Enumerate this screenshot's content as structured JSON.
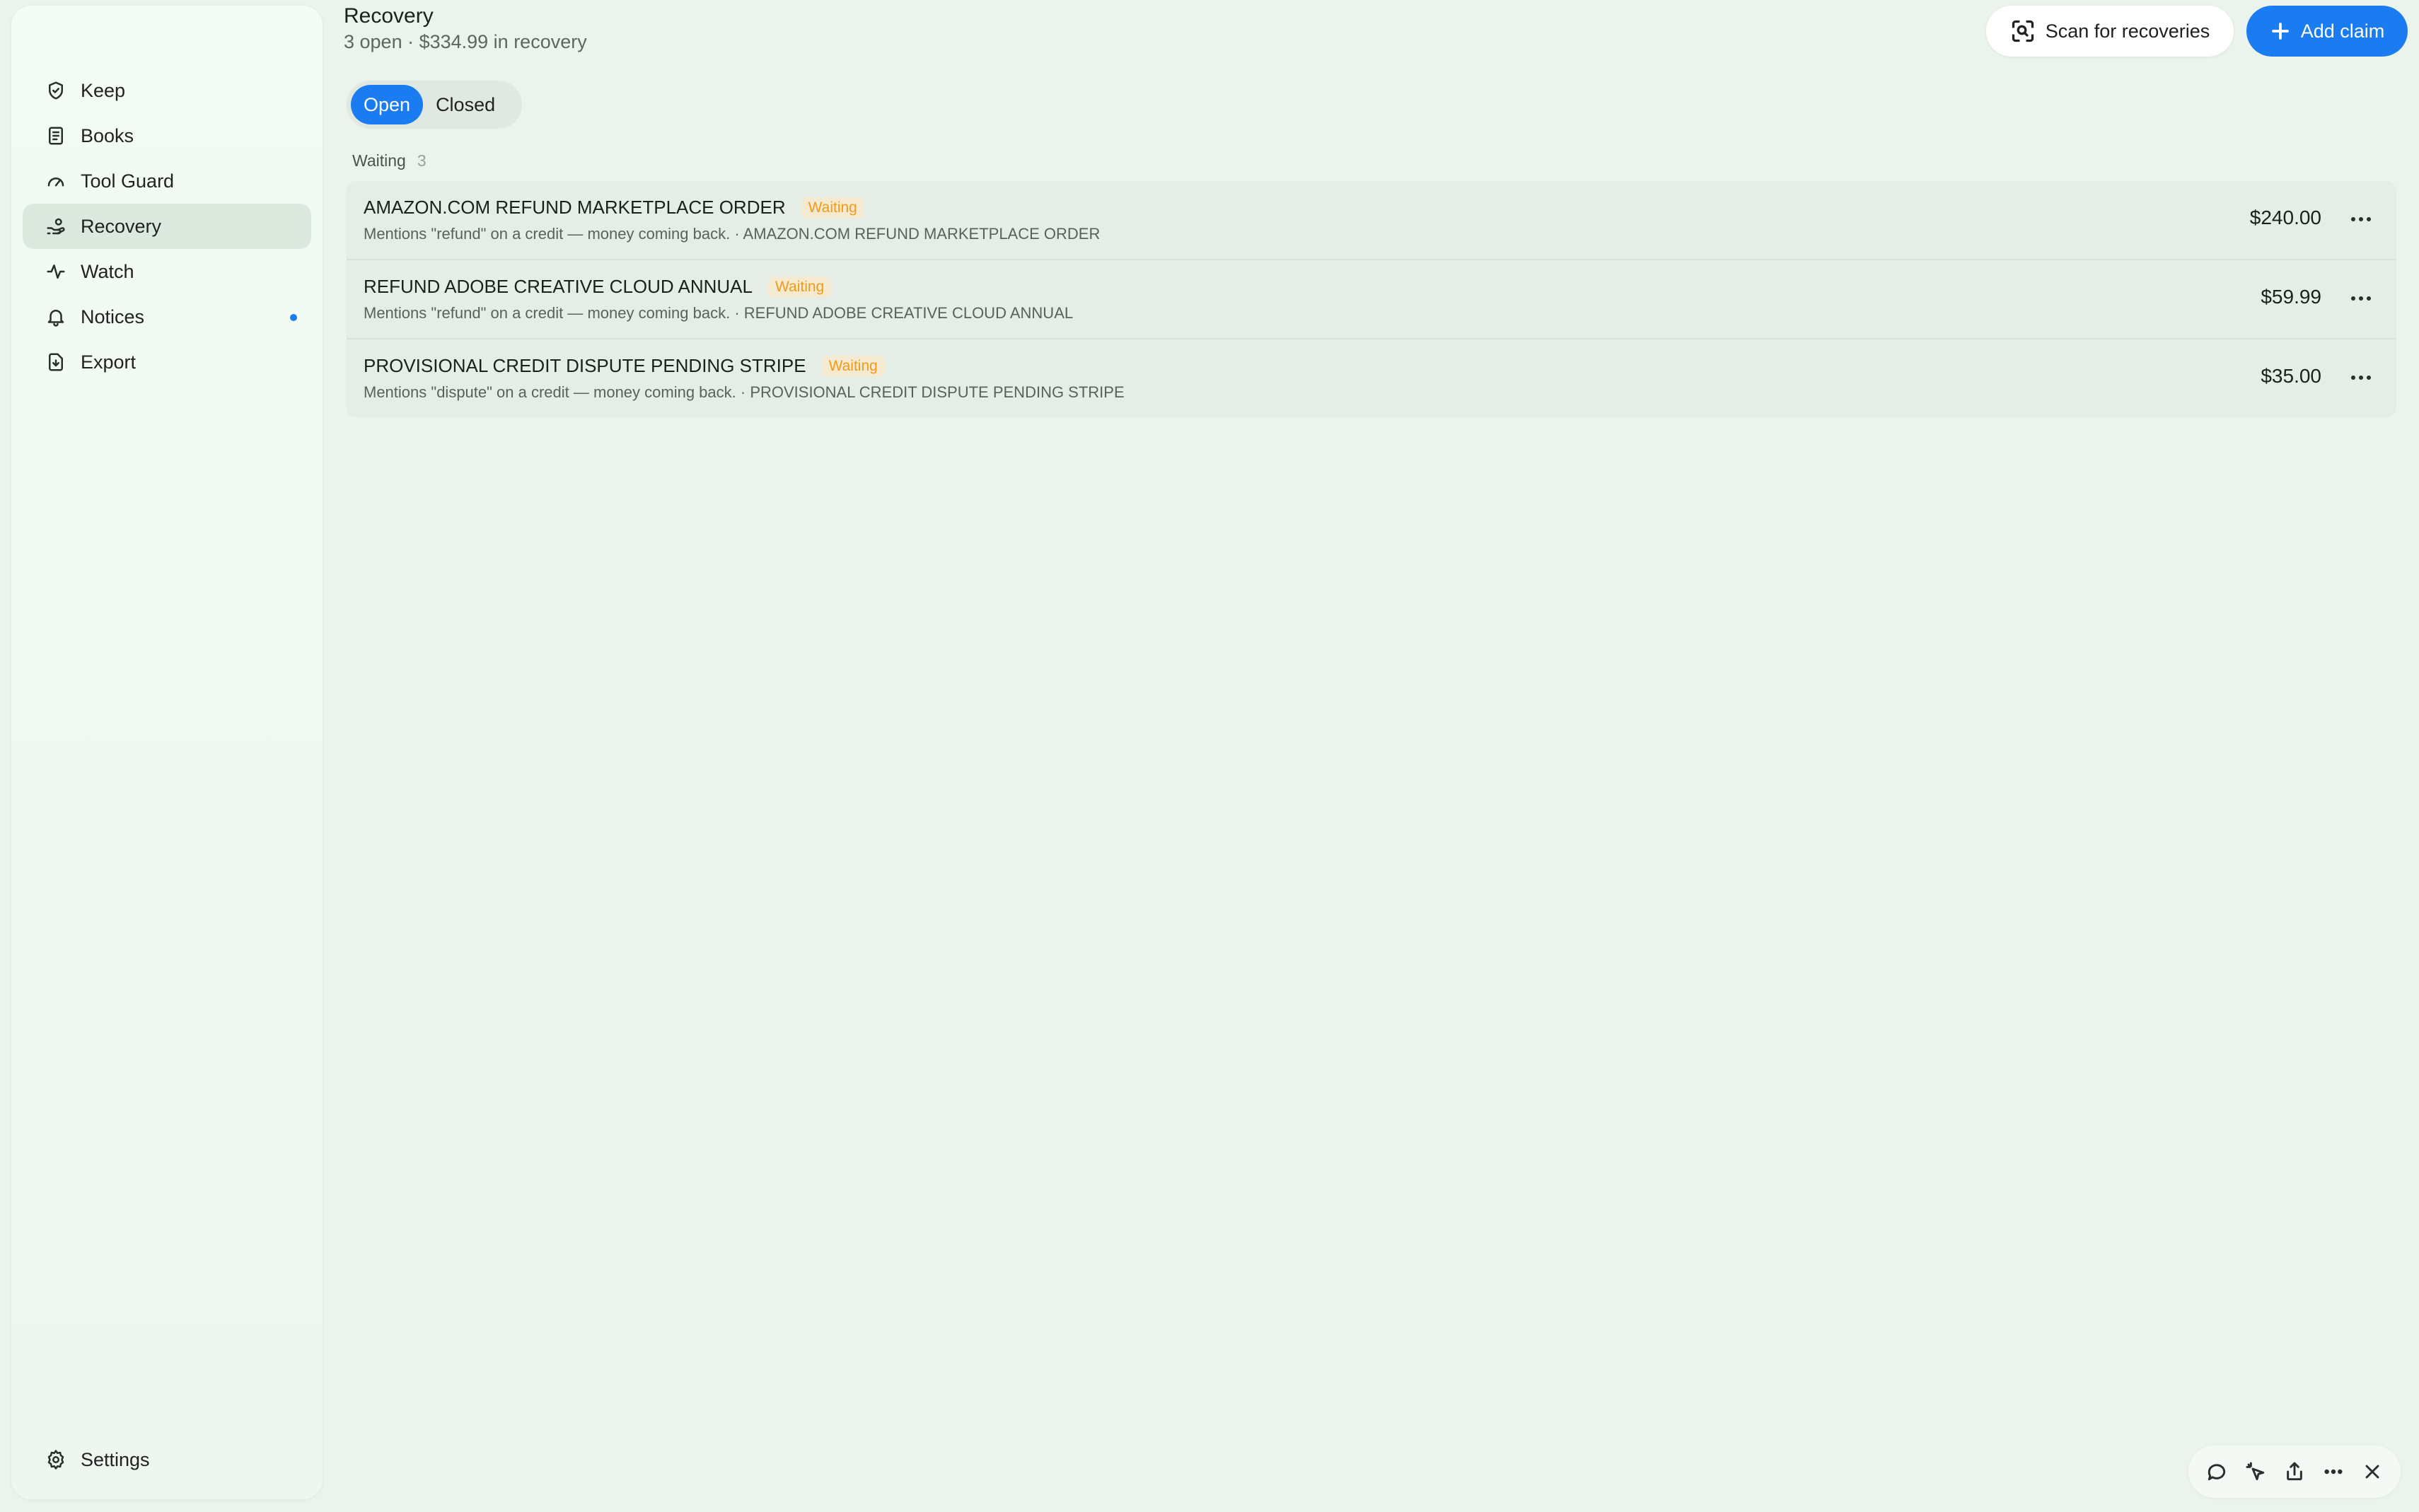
{
  "sidebar": {
    "items": [
      {
        "label": "Keep",
        "icon": "shield-check-icon"
      },
      {
        "label": "Books",
        "icon": "book-icon"
      },
      {
        "label": "Tool Guard",
        "icon": "gauge-icon"
      },
      {
        "label": "Recovery",
        "icon": "hand-coins-icon",
        "active": true
      },
      {
        "label": "Watch",
        "icon": "activity-icon"
      },
      {
        "label": "Notices",
        "icon": "bell-icon",
        "has_dot": true
      },
      {
        "label": "Export",
        "icon": "file-download-icon"
      }
    ],
    "settings_label": "Settings"
  },
  "header": {
    "title": "Recovery",
    "subtitle": "3 open · $334.99 in recovery"
  },
  "actions": {
    "scan_label": "Scan for recoveries",
    "add_label": "Add claim"
  },
  "tabs": {
    "open_label": "Open",
    "closed_label": "Closed",
    "selected": "Open"
  },
  "group": {
    "label": "Waiting",
    "count": "3"
  },
  "claims": [
    {
      "title": "AMAZON.COM REFUND MARKETPLACE ORDER",
      "status": "Waiting",
      "description": "Mentions \"refund\" on a credit — money coming back. · AMAZON.COM REFUND MARKETPLACE ORDER",
      "amount": "$240.00"
    },
    {
      "title": "REFUND ADOBE CREATIVE CLOUD ANNUAL",
      "status": "Waiting",
      "description": "Mentions \"refund\" on a credit — money coming back. · REFUND ADOBE CREATIVE CLOUD ANNUAL",
      "amount": "$59.99"
    },
    {
      "title": "PROVISIONAL CREDIT DISPUTE PENDING STRIPE",
      "status": "Waiting",
      "description": "Mentions \"dispute\" on a credit — money coming back. · PROVISIONAL CREDIT DISPUTE PENDING STRIPE",
      "amount": "$35.00"
    }
  ],
  "colors": {
    "accent": "#1a7cf0",
    "status_waiting": "#f29a17",
    "background": "#eaf3ec"
  }
}
